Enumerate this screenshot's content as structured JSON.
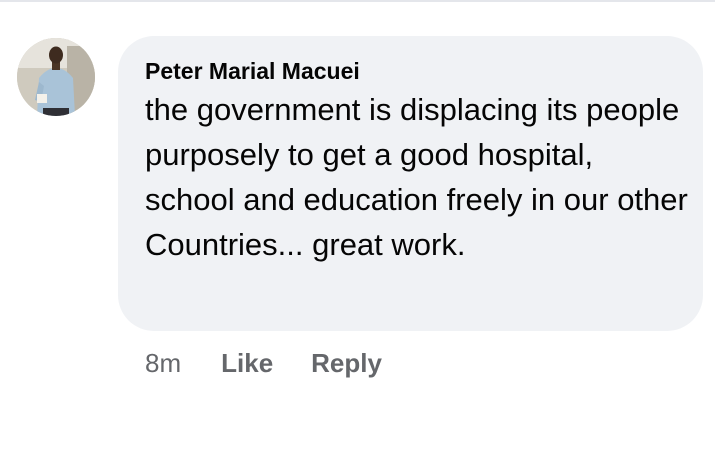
{
  "comment": {
    "author": "Peter Marial Macuei",
    "text": "the government is displacing its people purposely to get a good hospital, school and education freely in our other Countries... great work.",
    "timestamp": "8m",
    "actions": {
      "like_label": "Like",
      "reply_label": "Reply"
    }
  },
  "colors": {
    "bubble_background": "#f0f2f5",
    "text_primary": "#050505",
    "text_secondary": "#65676b"
  },
  "icons": {
    "avatar": "profile-photo-avatar"
  }
}
